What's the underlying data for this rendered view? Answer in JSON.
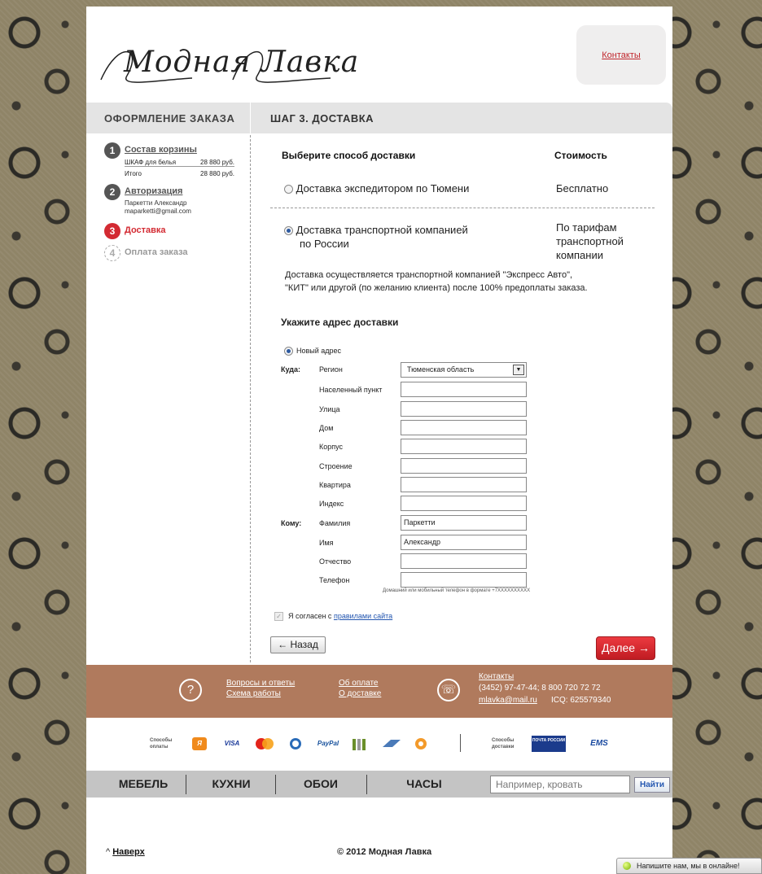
{
  "header": {
    "logo_text": "Модная Лавка",
    "contacts_link": "Контакты"
  },
  "titlebar": {
    "left": "ОФОРМЛЕНИЕ ЗАКАЗА",
    "right": "ШАГ 3. ДОСТАВКА"
  },
  "steps": [
    {
      "num": "1",
      "title": "Состав корзины",
      "state": "done"
    },
    {
      "num": "2",
      "title": "Авторизация",
      "state": "done"
    },
    {
      "num": "3",
      "title": "Доставка",
      "state": "active"
    },
    {
      "num": "4",
      "title": "Оплата заказа",
      "state": "disabled"
    }
  ],
  "cart": {
    "item_name": "ШКАФ для белья",
    "item_price": "28 880 руб.",
    "total_label": "Итого",
    "total_price": "28 880 руб."
  },
  "auth": {
    "name": "Паркетти Александр",
    "email": "maparketti@gmail.com"
  },
  "delivery": {
    "choose_header": "Выберите способ доставки",
    "cost_header": "Стоимость",
    "options": [
      {
        "label": "Доставка экспедитором по Тюмени",
        "cost": "Бесплатно",
        "selected": false
      },
      {
        "label_line1": "Доставка транспортной компанией",
        "label_line2": "по России",
        "cost_line1": "По тарифам",
        "cost_line2": "транспортной",
        "cost_line3": "компании",
        "selected": true
      }
    ],
    "note_line1": "Доставка осуществляется транспортной компанией \"Экспресс Авто\",",
    "note_line2": "\"КИТ\" или другой (по желанию клиента) после 100% предоплаты заказа."
  },
  "address": {
    "title": "Укажите адрес доставки",
    "new_address": "Новый адрес",
    "where_label": "Куда:",
    "whom_label": "Кому:",
    "fields": [
      {
        "label": "Регион",
        "value": "Тюменская область",
        "type": "select"
      },
      {
        "label": "Населенный пункт",
        "value": ""
      },
      {
        "label": "Улица",
        "value": ""
      },
      {
        "label": "Дом",
        "value": ""
      },
      {
        "label": "Корпус",
        "value": ""
      },
      {
        "label": "Строение",
        "value": ""
      },
      {
        "label": "Квартира",
        "value": ""
      },
      {
        "label": "Индекс",
        "value": ""
      },
      {
        "label": "Фамилия",
        "value": "Паркетти"
      },
      {
        "label": "Имя",
        "value": "Александр"
      },
      {
        "label": "Отчество",
        "value": ""
      },
      {
        "label": "Телефон",
        "value": ""
      }
    ],
    "phone_hint": "Домашний или мобильный телефон в формате +7XXXXXXXXXX"
  },
  "agree": {
    "text": "Я согласен с",
    "link": "правилами сайта",
    "checked": true
  },
  "buttons": {
    "back": "← Назад",
    "next": "Далее →"
  },
  "footer": {
    "faq": "Вопросы и ответы",
    "schedule": "Схема работы",
    "about_payment": "Об оплате",
    "about_delivery": "О доставке",
    "contacts": "Контакты",
    "phones": "(3452) 97-47-44; 8 800 720 72 72",
    "email": "mlavka@mail.ru",
    "icq": "ICQ: 625579340",
    "question_icon": "?",
    "phone_icon": "☏"
  },
  "payments": {
    "pay_caption_1": "Способы",
    "pay_caption_2": "оплаты",
    "delivery_caption_1": "Способы",
    "delivery_caption_2": "доставки",
    "icons": [
      "yandex-money-icon",
      "visa-icon",
      "mastercard-icon",
      "webmoney-icon",
      "paypal-icon",
      "qiwi-icon",
      "rbk-icon",
      "money-mail-icon"
    ],
    "visa": "VISA",
    "paypal": "PayPal",
    "ems": "EMS",
    "post": "ПОЧТА РОССИИ"
  },
  "nav": {
    "items": [
      "МЕБЕЛЬ",
      "КУХНИ",
      "ОБОИ",
      "ЧАСЫ"
    ],
    "search_placeholder": "Например, кровать",
    "search_button": "Найти"
  },
  "bottom": {
    "up_arrow": "^",
    "up_link": "Наверх",
    "copyright": "©  2012 Модная Лавка"
  },
  "chat": {
    "text": "Напишите нам, мы в онлайне!"
  },
  "colors": {
    "accent_red": "#d32a32",
    "footer_brown": "#b07a5d",
    "nav_gray": "#c4c4c4"
  }
}
